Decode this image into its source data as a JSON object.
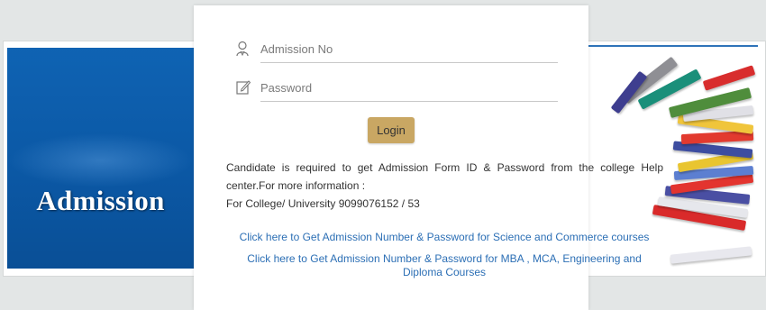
{
  "banner": {
    "left_title": "Admission"
  },
  "login": {
    "admission_no_placeholder": "Admission No",
    "password_placeholder": "Password",
    "login_label": "Login"
  },
  "info": {
    "text": "Candidate is required to get Admission Form ID & Password from the college Help center.For more information :",
    "contact": "For College/ University 9099076152 / 53"
  },
  "links": {
    "science_commerce": "Click here to Get Admission Number & Password for Science and Commerce courses",
    "mba_mca_line1": "Click here to Get Admission Number & Password for MBA , MCA, Engineering and",
    "mba_mca_line2": "Diploma Courses"
  },
  "colors": {
    "left_panel_blue": "#0b58a5",
    "login_button": "#c9a763",
    "link_blue": "#2c6fb5"
  }
}
